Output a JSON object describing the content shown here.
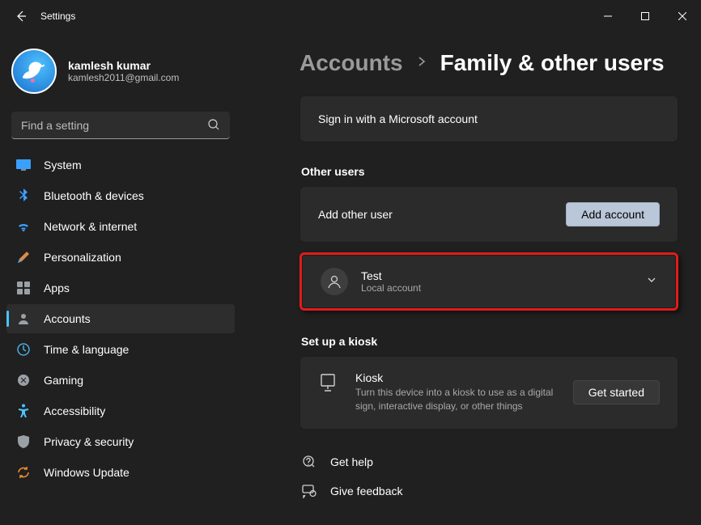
{
  "titlebar": {
    "app_name": "Settings"
  },
  "profile": {
    "name": "kamlesh kumar",
    "email": "kamlesh2011@gmail.com"
  },
  "search": {
    "placeholder": "Find a setting"
  },
  "nav": {
    "items": [
      {
        "label": "System"
      },
      {
        "label": "Bluetooth & devices"
      },
      {
        "label": "Network & internet"
      },
      {
        "label": "Personalization"
      },
      {
        "label": "Apps"
      },
      {
        "label": "Accounts"
      },
      {
        "label": "Time & language"
      },
      {
        "label": "Gaming"
      },
      {
        "label": "Accessibility"
      },
      {
        "label": "Privacy & security"
      },
      {
        "label": "Windows Update"
      }
    ],
    "active_index": 5
  },
  "breadcrumb": {
    "parent": "Accounts",
    "current": "Family & other users"
  },
  "signin": {
    "text": "Sign in with a Microsoft account"
  },
  "other_users": {
    "heading": "Other users",
    "add_label": "Add other user",
    "add_button": "Add account",
    "users": [
      {
        "name": "Test",
        "subtitle": "Local account"
      }
    ]
  },
  "kiosk": {
    "heading": "Set up a kiosk",
    "title": "Kiosk",
    "description": "Turn this device into a kiosk to use as a digital sign, interactive display, or other things",
    "button": "Get started"
  },
  "footer": {
    "help": "Get help",
    "feedback": "Give feedback"
  }
}
